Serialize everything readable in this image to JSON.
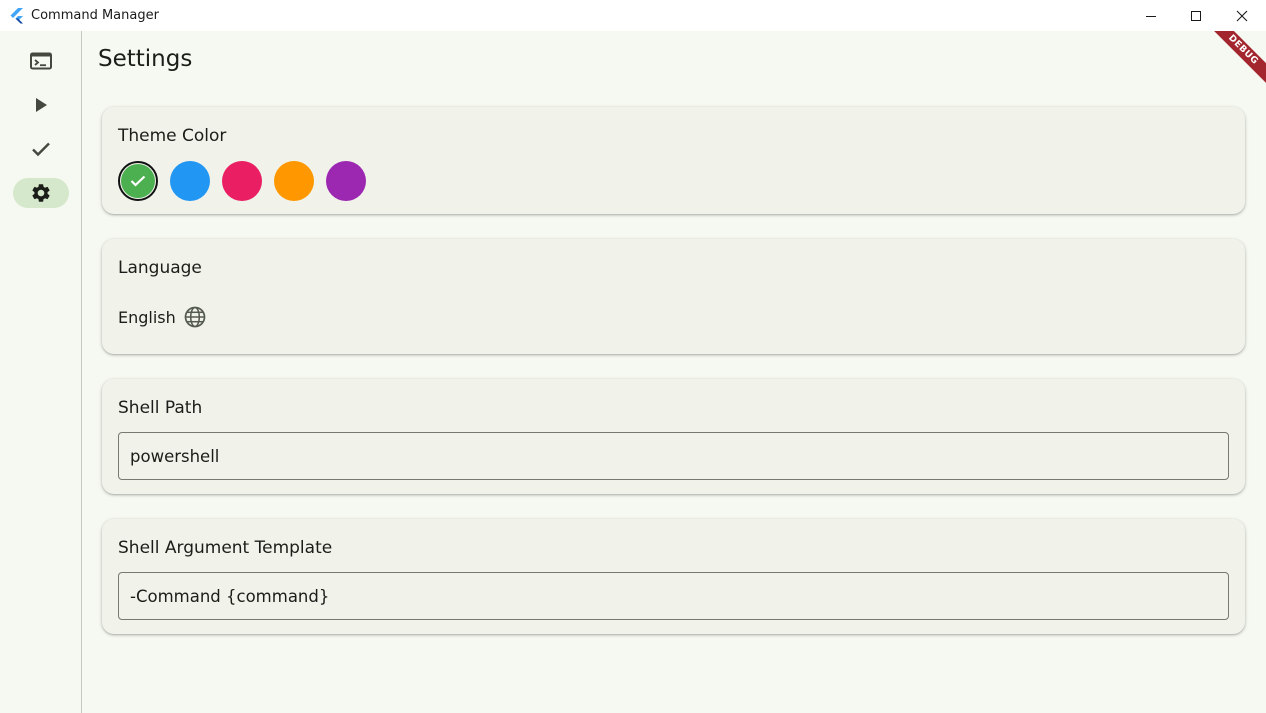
{
  "window": {
    "title": "Command Manager"
  },
  "debug_banner": "DEBUG",
  "nav_rail": {
    "items": [
      {
        "icon": "terminal-icon",
        "active": false
      },
      {
        "icon": "play-icon",
        "active": false
      },
      {
        "icon": "check-icon",
        "active": false
      },
      {
        "icon": "gear-icon",
        "active": true
      }
    ]
  },
  "settings": {
    "title": "Settings",
    "theme_color": {
      "label": "Theme Color",
      "colors": [
        "#4caf50",
        "#2196f3",
        "#e91e63",
        "#ff9800",
        "#9c27b0"
      ],
      "selected": "#4caf50"
    },
    "language": {
      "label": "Language",
      "value": "English"
    },
    "shell_path": {
      "label": "Shell Path",
      "value": "powershell"
    },
    "shell_argument_template": {
      "label": "Shell Argument Template",
      "value": "-Command {command}"
    }
  },
  "colors": {
    "accent": "#4caf50",
    "background": "#f6f9f1",
    "card": "#f1f3eb",
    "rail_active": "#d6e8cc"
  }
}
